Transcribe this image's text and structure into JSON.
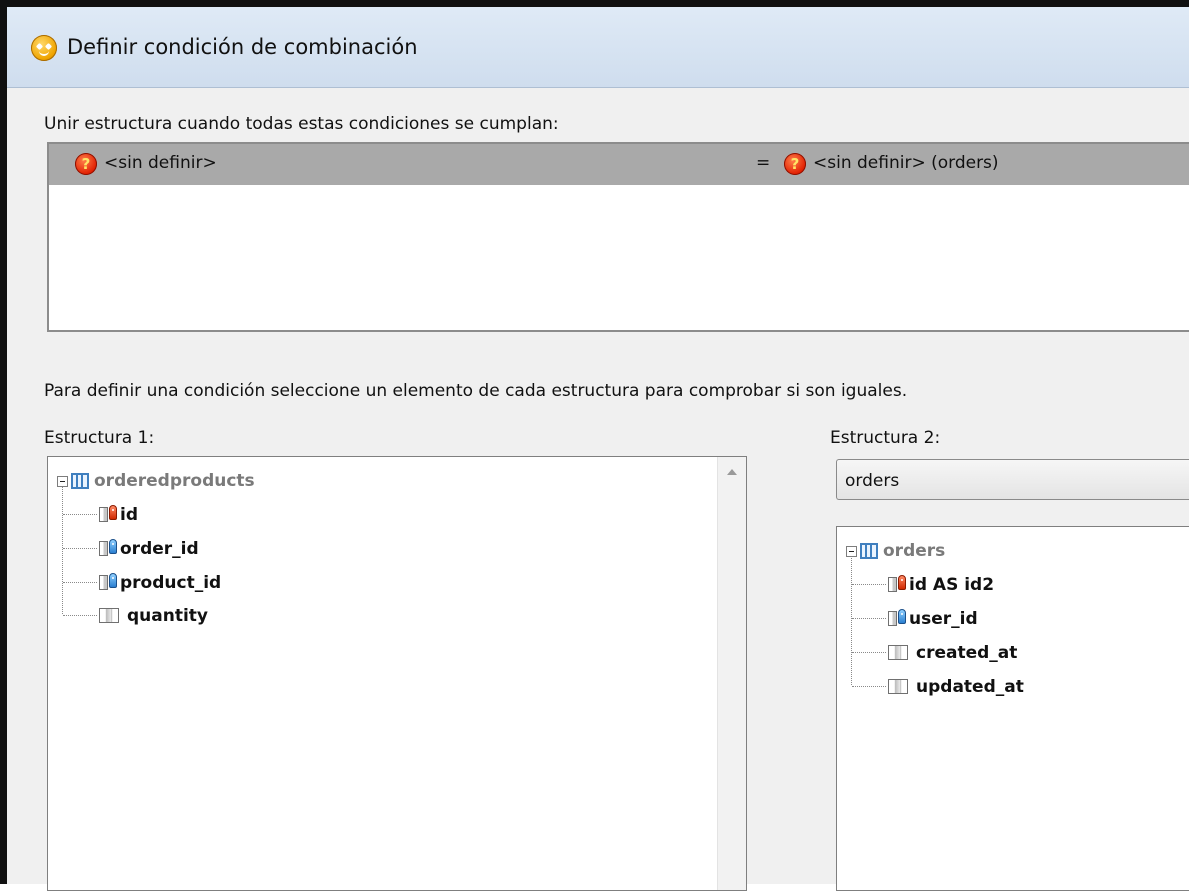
{
  "dialog": {
    "title": "Definir condición de combinación",
    "instruction_top": "Unir estructura cuando todas estas condiciones se cumplan:",
    "instruction_middle": "Para definir una condición seleccione un elemento de cada estructura para comprobar si son iguales."
  },
  "condition": {
    "left": "<sin definir>",
    "operator": "=",
    "right": "<sin definir> (orders)",
    "icon": "question-icon"
  },
  "structure1": {
    "label": "Estructura 1:",
    "root": "orderedproducts",
    "fields": [
      {
        "name": "id",
        "icon": "primary-key-column-icon"
      },
      {
        "name": "order_id",
        "icon": "foreign-key-column-icon"
      },
      {
        "name": "product_id",
        "icon": "foreign-key-column-icon"
      },
      {
        "name": "quantity",
        "icon": "column-icon"
      }
    ]
  },
  "structure2": {
    "label": "Estructura 2:",
    "selected": "orders",
    "root": "orders",
    "fields": [
      {
        "name": "id AS id2",
        "icon": "primary-key-column-icon"
      },
      {
        "name": "user_id",
        "icon": "foreign-key-column-icon"
      },
      {
        "name": "created_at",
        "icon": "column-icon"
      },
      {
        "name": "updated_at",
        "icon": "column-icon"
      }
    ]
  }
}
